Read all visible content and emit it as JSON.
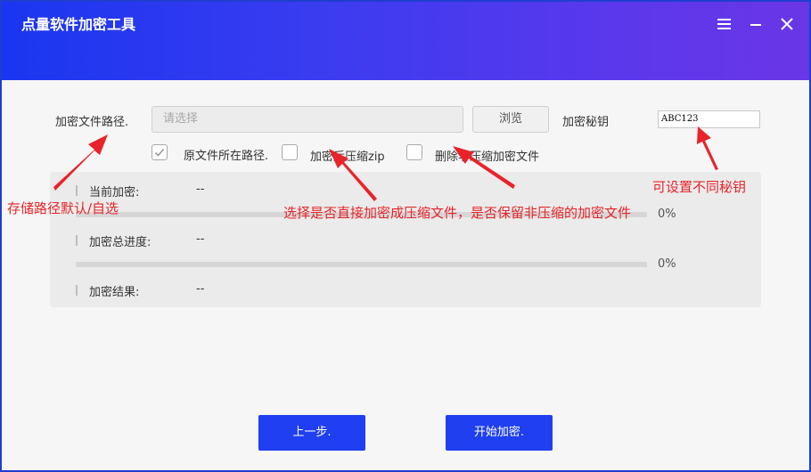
{
  "window": {
    "title": "点量软件加密工具",
    "controls": [
      "menu-icon",
      "minimize-icon",
      "close-icon"
    ],
    "accent_color": "#1f3ff0"
  },
  "form": {
    "path_label": "加密文件路径.",
    "path_placeholder": "请选择",
    "browse_label": "浏览",
    "key_label": "加密秘钥",
    "key_value": "ABC123"
  },
  "options": [
    {
      "label": "原文件所在路径.",
      "checked": true
    },
    {
      "label": "加密后压缩zip",
      "checked": false
    },
    {
      "label": "删除非压缩加密文件",
      "checked": false
    }
  ],
  "progress": {
    "current_label": "当前加密:",
    "current_value": "--",
    "current_percent": "0%",
    "total_label": "加密总进度:",
    "total_value": "--",
    "total_percent": "0%",
    "result_label": "加密结果:",
    "result_value": "--"
  },
  "actions": {
    "prev_label": "上一步.",
    "start_label": "开始加密."
  },
  "annotations": {
    "path_note": "存储路径默认/自选",
    "options_note": "选择是否直接加密成压缩文件，是否保留非压缩的加密文件",
    "key_note": "可设置不同秘钥",
    "color": "#e8242a"
  }
}
